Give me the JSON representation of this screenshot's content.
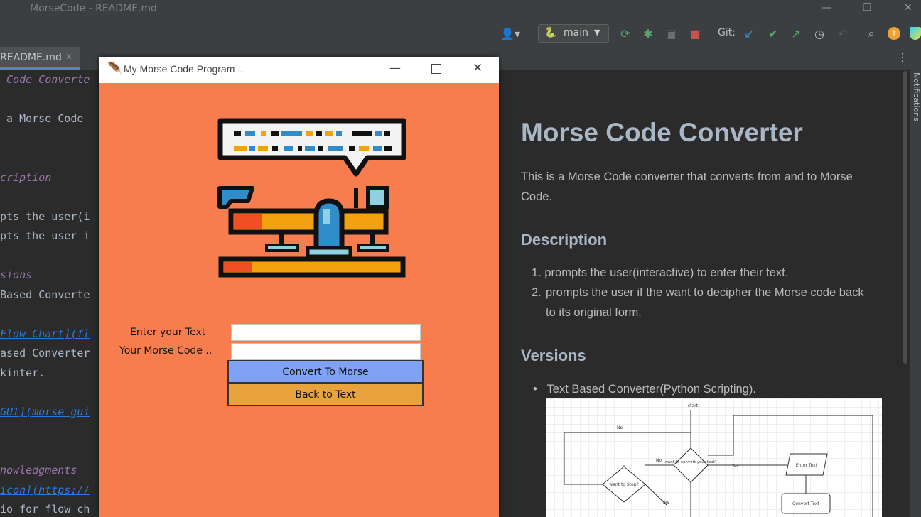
{
  "ide": {
    "window_title": "MorseCode - README.md",
    "branch": "main",
    "git_label": "Git:",
    "tab_label": "README.md",
    "notifications_label": "Notifications"
  },
  "editor_lines": [
    {
      "text": " Code Converte",
      "color": "#9876aa",
      "italic": true
    },
    {
      "text": "",
      "color": "#a9b7c6"
    },
    {
      "text": " a Morse Code ",
      "color": "#a9b7c6"
    },
    {
      "text": "",
      "color": "#a9b7c6"
    },
    {
      "text": "",
      "color": "#a9b7c6"
    },
    {
      "text": "cription",
      "color": "#9876aa",
      "italic": true
    },
    {
      "text": "",
      "color": "#a9b7c6"
    },
    {
      "text": "pts the user(i",
      "color": "#a9b7c6"
    },
    {
      "text": "pts the user i",
      "color": "#a9b7c6"
    },
    {
      "text": "",
      "color": "#a9b7c6"
    },
    {
      "text": "sions",
      "color": "#9876aa",
      "italic": true
    },
    {
      "text": "Based Converte",
      "color": "#a9b7c6"
    },
    {
      "text": "",
      "color": "#a9b7c6"
    },
    {
      "text": "Flow Chart](fl",
      "color": "#287bde",
      "italic": true
    },
    {
      "text": "ased Converter",
      "color": "#a9b7c6"
    },
    {
      "text": "kinter.",
      "color": "#a9b7c6"
    },
    {
      "text": "",
      "color": "#a9b7c6"
    },
    {
      "text": "GUI](morse_gui",
      "color": "#287bde",
      "italic": true
    },
    {
      "text": "",
      "color": "#a9b7c6"
    },
    {
      "text": "",
      "color": "#a9b7c6"
    },
    {
      "text": "nowledgments",
      "color": "#9876aa",
      "italic": true
    },
    {
      "text": "icon](https://",
      "color": "#287bde",
      "italic": true
    },
    {
      "text": "io for flow ch",
      "color": "#a9b7c6"
    }
  ],
  "preview": {
    "title": "Morse Code Converter",
    "intro": "This is a Morse Code converter that converts from and to Morse Code.",
    "description_heading": "Description",
    "description_items": [
      "prompts the user(interactive) to enter their text.",
      "prompts the user if the want to decipher the Morse code back to its original form."
    ],
    "versions_heading": "Versions",
    "versions_items": [
      "Text Based Converter(Python Scripting)."
    ],
    "flowchart": {
      "start": "start",
      "no_label": "No",
      "no_label_2": "No",
      "yes_label": "Yes",
      "yes_label_2": "Yes",
      "want_to_convert": "want to convert your text?",
      "want_to_stop": "want to Stop?",
      "enter_text": "Enter Text",
      "convert_text": "Convert Text"
    }
  },
  "app": {
    "title": "My Morse Code Program ..",
    "enter_text_label": "Enter your Text",
    "morse_label": "Your Morse Code ..",
    "enter_text_value": "",
    "morse_value": "",
    "convert_button": "Convert To Morse",
    "back_button": "Back to Text",
    "colors": {
      "background": "#f77d4e",
      "convert_button": "#7fa2f5",
      "back_button": "#e8a33c"
    }
  }
}
